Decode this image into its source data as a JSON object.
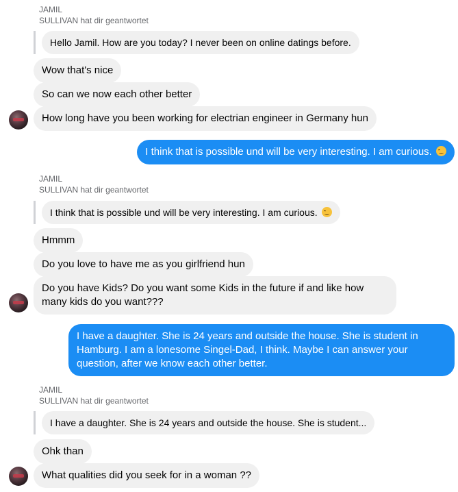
{
  "messages": {
    "reply_1": {
      "sender_name": "JAMIL",
      "reply_label": "SULLIVAN hat dir geantwortet",
      "quoted_text": "Hello Jamil. How are you today? I never been on online datings before."
    },
    "incoming_1": "Wow that's nice",
    "incoming_2": "So can we now each other better",
    "incoming_3": "How long have you been working for electrian engineer in Germany hun",
    "outgoing_1": "I think that is possible und will be very interesting. I am curious.",
    "reply_2": {
      "sender_name": "JAMIL",
      "reply_label": "SULLIVAN hat dir geantwortet",
      "quoted_text": "I think that is possible und will be very interesting. I am curious."
    },
    "incoming_4": "Hmmm",
    "incoming_5": "Do you love to have me as you girlfriend hun",
    "incoming_6": "Do you have Kids? Do you want some Kids in the future if and like how many kids do you want???",
    "outgoing_2": "I have a daughter. She is 24 years and outside the house. She is student in Hamburg. I am a lonesome Singel-Dad, I think. Maybe I can answer your question, after we know each other better.",
    "reply_3": {
      "sender_name": "JAMIL",
      "reply_label": "SULLIVAN hat dir geantwortet",
      "quoted_text": "I have a daughter. She is 24 years and outside the house. She is student..."
    },
    "incoming_7": "Ohk than",
    "incoming_8": "What qualities did you seek for in a woman ??"
  },
  "icons": {
    "emoji": "smiling-face-emoji-icon",
    "avatar": "contact-avatar"
  },
  "colors": {
    "outgoing_bubble": "#1b8df4",
    "incoming_bubble": "#f0f0f0",
    "reply_label": "#65676b"
  }
}
